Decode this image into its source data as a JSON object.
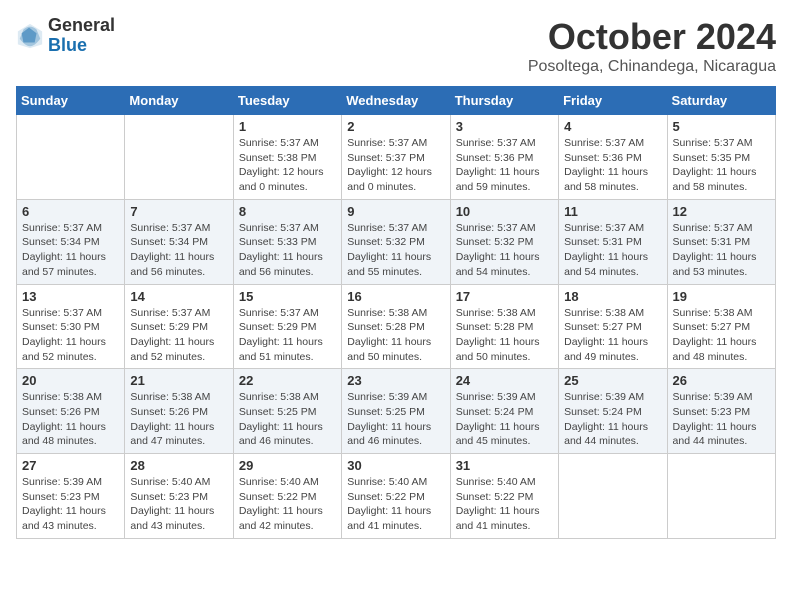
{
  "header": {
    "logo_general": "General",
    "logo_blue": "Blue",
    "month_title": "October 2024",
    "location": "Posoltega, Chinandega, Nicaragua"
  },
  "days_of_week": [
    "Sunday",
    "Monday",
    "Tuesday",
    "Wednesday",
    "Thursday",
    "Friday",
    "Saturday"
  ],
  "weeks": [
    [
      {
        "day": "",
        "info": ""
      },
      {
        "day": "",
        "info": ""
      },
      {
        "day": "1",
        "info": "Sunrise: 5:37 AM\nSunset: 5:38 PM\nDaylight: 12 hours\nand 0 minutes."
      },
      {
        "day": "2",
        "info": "Sunrise: 5:37 AM\nSunset: 5:37 PM\nDaylight: 12 hours\nand 0 minutes."
      },
      {
        "day": "3",
        "info": "Sunrise: 5:37 AM\nSunset: 5:36 PM\nDaylight: 11 hours\nand 59 minutes."
      },
      {
        "day": "4",
        "info": "Sunrise: 5:37 AM\nSunset: 5:36 PM\nDaylight: 11 hours\nand 58 minutes."
      },
      {
        "day": "5",
        "info": "Sunrise: 5:37 AM\nSunset: 5:35 PM\nDaylight: 11 hours\nand 58 minutes."
      }
    ],
    [
      {
        "day": "6",
        "info": "Sunrise: 5:37 AM\nSunset: 5:34 PM\nDaylight: 11 hours\nand 57 minutes."
      },
      {
        "day": "7",
        "info": "Sunrise: 5:37 AM\nSunset: 5:34 PM\nDaylight: 11 hours\nand 56 minutes."
      },
      {
        "day": "8",
        "info": "Sunrise: 5:37 AM\nSunset: 5:33 PM\nDaylight: 11 hours\nand 56 minutes."
      },
      {
        "day": "9",
        "info": "Sunrise: 5:37 AM\nSunset: 5:32 PM\nDaylight: 11 hours\nand 55 minutes."
      },
      {
        "day": "10",
        "info": "Sunrise: 5:37 AM\nSunset: 5:32 PM\nDaylight: 11 hours\nand 54 minutes."
      },
      {
        "day": "11",
        "info": "Sunrise: 5:37 AM\nSunset: 5:31 PM\nDaylight: 11 hours\nand 54 minutes."
      },
      {
        "day": "12",
        "info": "Sunrise: 5:37 AM\nSunset: 5:31 PM\nDaylight: 11 hours\nand 53 minutes."
      }
    ],
    [
      {
        "day": "13",
        "info": "Sunrise: 5:37 AM\nSunset: 5:30 PM\nDaylight: 11 hours\nand 52 minutes."
      },
      {
        "day": "14",
        "info": "Sunrise: 5:37 AM\nSunset: 5:29 PM\nDaylight: 11 hours\nand 52 minutes."
      },
      {
        "day": "15",
        "info": "Sunrise: 5:37 AM\nSunset: 5:29 PM\nDaylight: 11 hours\nand 51 minutes."
      },
      {
        "day": "16",
        "info": "Sunrise: 5:38 AM\nSunset: 5:28 PM\nDaylight: 11 hours\nand 50 minutes."
      },
      {
        "day": "17",
        "info": "Sunrise: 5:38 AM\nSunset: 5:28 PM\nDaylight: 11 hours\nand 50 minutes."
      },
      {
        "day": "18",
        "info": "Sunrise: 5:38 AM\nSunset: 5:27 PM\nDaylight: 11 hours\nand 49 minutes."
      },
      {
        "day": "19",
        "info": "Sunrise: 5:38 AM\nSunset: 5:27 PM\nDaylight: 11 hours\nand 48 minutes."
      }
    ],
    [
      {
        "day": "20",
        "info": "Sunrise: 5:38 AM\nSunset: 5:26 PM\nDaylight: 11 hours\nand 48 minutes."
      },
      {
        "day": "21",
        "info": "Sunrise: 5:38 AM\nSunset: 5:26 PM\nDaylight: 11 hours\nand 47 minutes."
      },
      {
        "day": "22",
        "info": "Sunrise: 5:38 AM\nSunset: 5:25 PM\nDaylight: 11 hours\nand 46 minutes."
      },
      {
        "day": "23",
        "info": "Sunrise: 5:39 AM\nSunset: 5:25 PM\nDaylight: 11 hours\nand 46 minutes."
      },
      {
        "day": "24",
        "info": "Sunrise: 5:39 AM\nSunset: 5:24 PM\nDaylight: 11 hours\nand 45 minutes."
      },
      {
        "day": "25",
        "info": "Sunrise: 5:39 AM\nSunset: 5:24 PM\nDaylight: 11 hours\nand 44 minutes."
      },
      {
        "day": "26",
        "info": "Sunrise: 5:39 AM\nSunset: 5:23 PM\nDaylight: 11 hours\nand 44 minutes."
      }
    ],
    [
      {
        "day": "27",
        "info": "Sunrise: 5:39 AM\nSunset: 5:23 PM\nDaylight: 11 hours\nand 43 minutes."
      },
      {
        "day": "28",
        "info": "Sunrise: 5:40 AM\nSunset: 5:23 PM\nDaylight: 11 hours\nand 43 minutes."
      },
      {
        "day": "29",
        "info": "Sunrise: 5:40 AM\nSunset: 5:22 PM\nDaylight: 11 hours\nand 42 minutes."
      },
      {
        "day": "30",
        "info": "Sunrise: 5:40 AM\nSunset: 5:22 PM\nDaylight: 11 hours\nand 41 minutes."
      },
      {
        "day": "31",
        "info": "Sunrise: 5:40 AM\nSunset: 5:22 PM\nDaylight: 11 hours\nand 41 minutes."
      },
      {
        "day": "",
        "info": ""
      },
      {
        "day": "",
        "info": ""
      }
    ]
  ]
}
